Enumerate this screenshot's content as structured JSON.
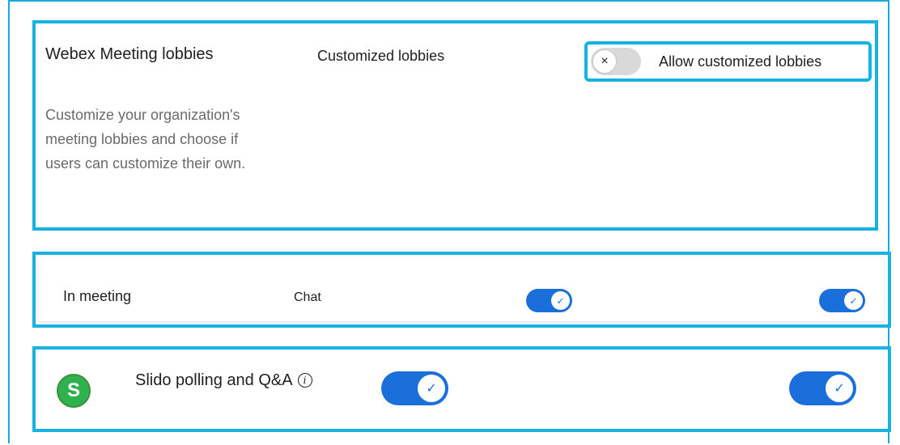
{
  "lobbies": {
    "title": "Webex Meeting lobbies",
    "description": "Customize your organization's meeting lobbies and choose if users can customize their own.",
    "setting_label": "Customized lobbies",
    "toggle": {
      "state": "off",
      "icon": "x-icon",
      "glyph": "×"
    },
    "allow_label": "Allow customized lobbies"
  },
  "in_meeting": {
    "title": "In meeting",
    "setting_label": "Chat",
    "toggles": [
      {
        "state": "on",
        "icon": "check-icon",
        "glyph": "✓"
      },
      {
        "state": "on",
        "icon": "check-icon",
        "glyph": "✓"
      }
    ]
  },
  "slido": {
    "logo_letter": "S",
    "title": "Slido polling and Q&A",
    "info_glyph": "i",
    "toggles": [
      {
        "state": "on",
        "icon": "check-icon",
        "glyph": "✓"
      },
      {
        "state": "on",
        "icon": "check-icon",
        "glyph": "✓"
      }
    ]
  },
  "colors": {
    "highlight_border": "#18b2e2",
    "toggle_on": "#1a6fdb",
    "toggle_off": "#d9d9d9",
    "slido_green": "#2fb24d"
  }
}
